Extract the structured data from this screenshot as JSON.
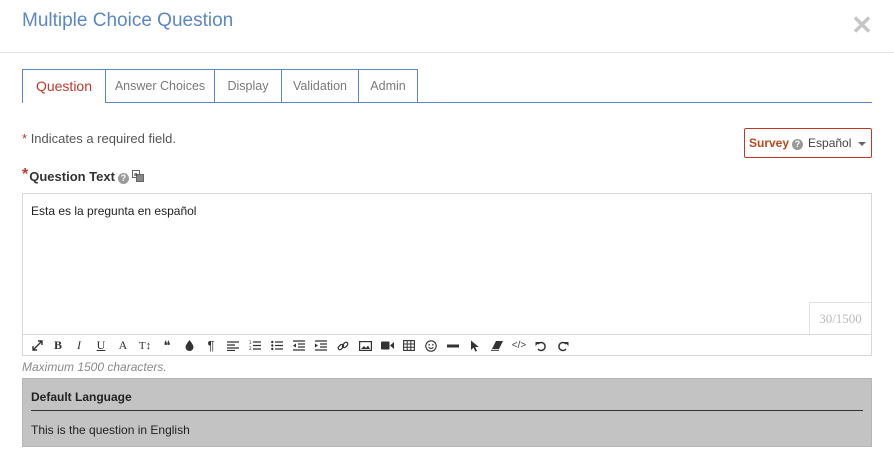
{
  "dialog": {
    "title": "Multiple Choice Question",
    "close_icon": "close-icon"
  },
  "tabs": [
    {
      "label": "Question",
      "active": true
    },
    {
      "label": "Answer Choices",
      "active": false
    },
    {
      "label": "Display",
      "active": false
    },
    {
      "label": "Validation",
      "active": false
    },
    {
      "label": "Admin",
      "active": false
    }
  ],
  "required_note": {
    "star": "*",
    "text": "Indicates a required field."
  },
  "language_selector": {
    "label": "Survey",
    "help_icon": "?",
    "selected": "Español"
  },
  "question_text": {
    "star": "*",
    "label": "Question Text",
    "help_icon": "?",
    "value": "Esta es la pregunta en español",
    "counter": "30/1500",
    "max_note": "Maximum 1500 characters."
  },
  "toolbar": {
    "buttons": [
      "fullscreen-icon",
      "bold-icon",
      "italic-icon",
      "underline-icon",
      "font-icon",
      "font-size-icon",
      "quote-icon",
      "color-icon",
      "paragraph-icon",
      "align-icon",
      "ordered-list-icon",
      "unordered-list-icon",
      "outdent-icon",
      "indent-icon",
      "link-icon",
      "image-icon",
      "video-icon",
      "table-icon",
      "emoticon-icon",
      "horizontal-rule-icon",
      "select-all-icon",
      "clear-formatting-icon",
      "code-view-icon",
      "undo-icon",
      "redo-icon"
    ],
    "glyphs": {
      "bold": "B",
      "italic": "I",
      "underline": "U",
      "font": "A",
      "font_size": "T↕",
      "quote": "❝",
      "paragraph": "¶",
      "code": "</>"
    }
  },
  "default_language": {
    "title": "Default Language",
    "text": "This is the question in English"
  },
  "colors": {
    "accent_blue": "#5b87c7",
    "required_red": "#c0392b",
    "panel_gray": "#c3c3c3"
  }
}
